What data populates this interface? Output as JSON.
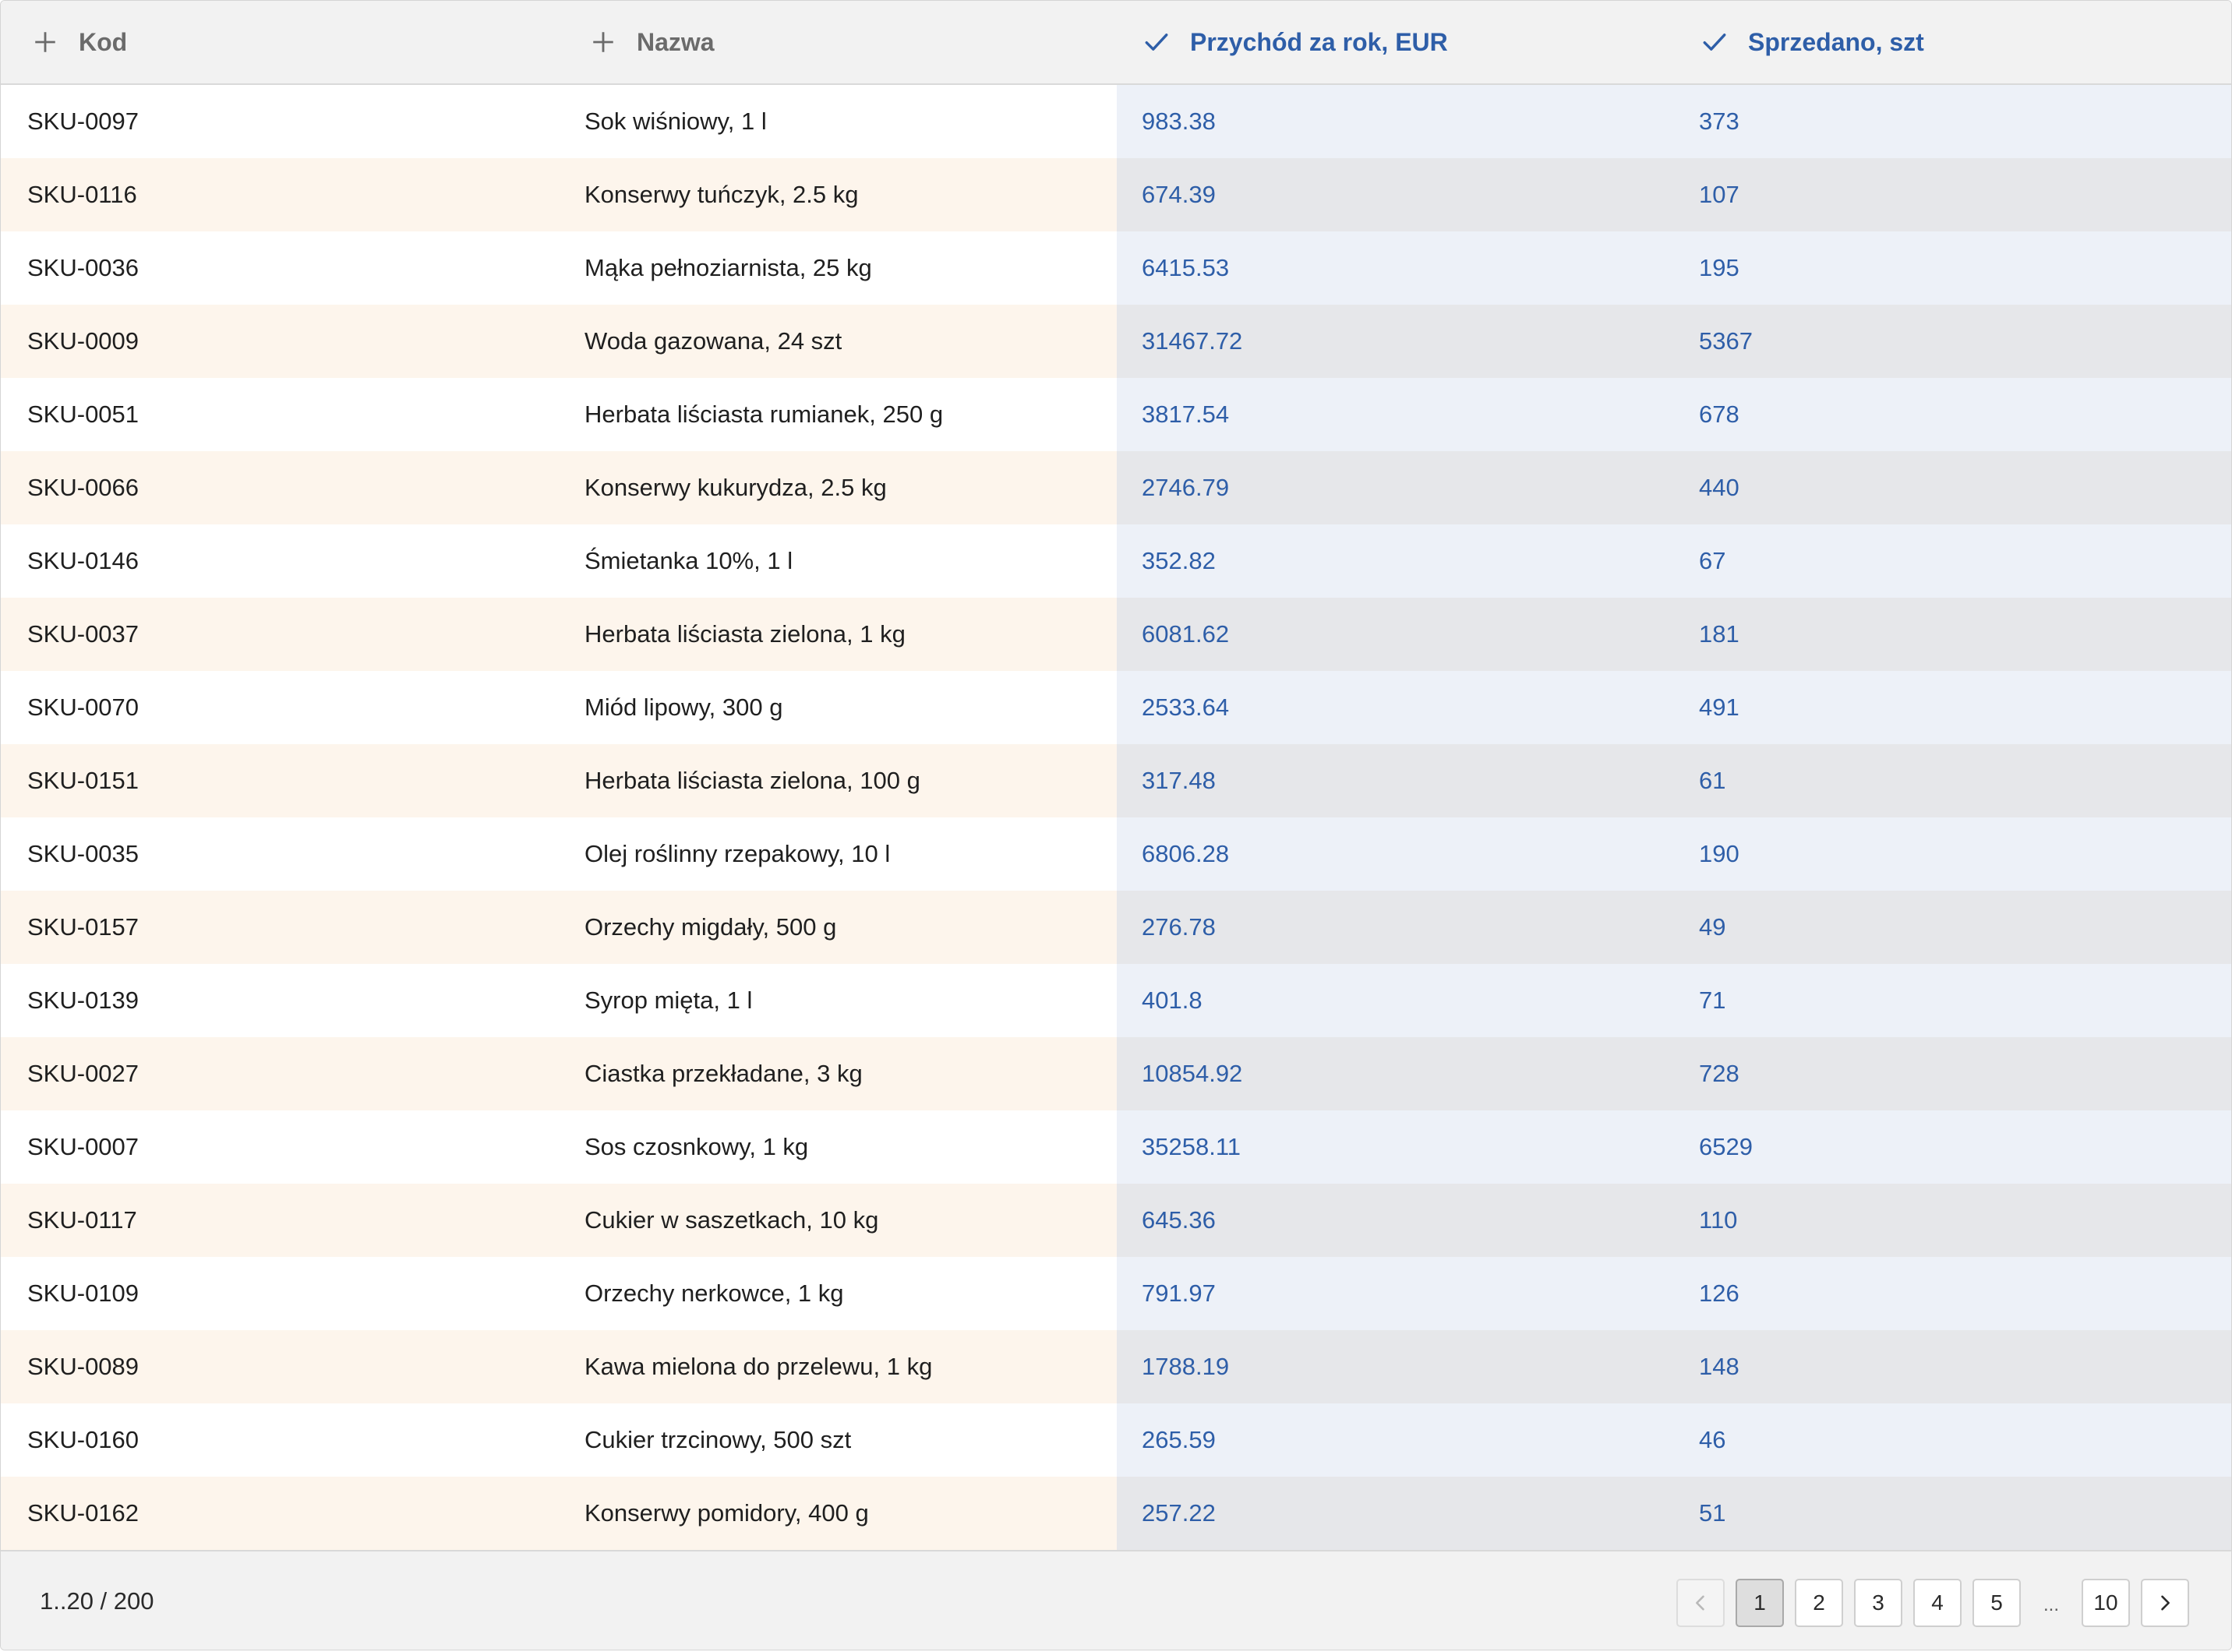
{
  "columns": [
    {
      "label": "Kod",
      "icon": "plus-icon"
    },
    {
      "label": "Nazwa",
      "icon": "plus-icon"
    },
    {
      "label": "Przychód za rok, EUR",
      "icon": "check-icon"
    },
    {
      "label": "Sprzedano, szt",
      "icon": "check-icon"
    }
  ],
  "rows": [
    [
      "SKU-0097",
      "Sok wiśniowy, 1 l",
      "983.38",
      "373"
    ],
    [
      "SKU-0116",
      "Konserwy tuńczyk, 2.5 kg",
      "674.39",
      "107"
    ],
    [
      "SKU-0036",
      "Mąka pełnoziarnista, 25 kg",
      "6415.53",
      "195"
    ],
    [
      "SKU-0009",
      "Woda gazowana, 24 szt",
      "31467.72",
      "5367"
    ],
    [
      "SKU-0051",
      "Herbata liściasta rumianek, 250 g",
      "3817.54",
      "678"
    ],
    [
      "SKU-0066",
      "Konserwy kukurydza, 2.5 kg",
      "2746.79",
      "440"
    ],
    [
      "SKU-0146",
      "Śmietanka 10%, 1 l",
      "352.82",
      "67"
    ],
    [
      "SKU-0037",
      "Herbata liściasta zielona, 1 kg",
      "6081.62",
      "181"
    ],
    [
      "SKU-0070",
      "Miód lipowy, 300 g",
      "2533.64",
      "491"
    ],
    [
      "SKU-0151",
      "Herbata liściasta zielona, 100 g",
      "317.48",
      "61"
    ],
    [
      "SKU-0035",
      "Olej roślinny rzepakowy, 10 l",
      "6806.28",
      "190"
    ],
    [
      "SKU-0157",
      "Orzechy migdały, 500 g",
      "276.78",
      "49"
    ],
    [
      "SKU-0139",
      "Syrop mięta, 1 l",
      "401.8",
      "71"
    ],
    [
      "SKU-0027",
      "Ciastka przekładane, 3 kg",
      "10854.92",
      "728"
    ],
    [
      "SKU-0007",
      "Sos czosnkowy, 1 kg",
      "35258.11",
      "6529"
    ],
    [
      "SKU-0117",
      "Cukier w saszetkach, 10 kg",
      "645.36",
      "110"
    ],
    [
      "SKU-0109",
      "Orzechy nerkowce, 1 kg",
      "791.97",
      "126"
    ],
    [
      "SKU-0089",
      "Kawa mielona do przelewu, 1 kg",
      "1788.19",
      "148"
    ],
    [
      "SKU-0160",
      "Cukier trzcinowy, 500 szt",
      "265.59",
      "46"
    ],
    [
      "SKU-0162",
      "Konserwy pomidory, 400 g",
      "257.22",
      "51"
    ]
  ],
  "footer": {
    "range": "1..20 / 200",
    "pages": [
      "1",
      "2",
      "3",
      "4",
      "5"
    ],
    "ellipsis": "...",
    "last_page": "10",
    "active_page": "1",
    "prev_icon": "chevron-left-icon",
    "next_icon": "chevron-right-icon"
  },
  "colors": {
    "accent": "#2e5ea8",
    "header_bg": "#f2f2f2",
    "row_warm": "#fdf5ec",
    "sorted_col_light": "#edf1f8",
    "sorted_col_dark": "#e6e7ea"
  }
}
